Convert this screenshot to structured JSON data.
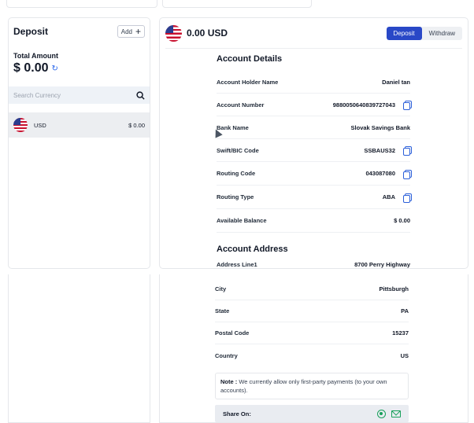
{
  "left": {
    "title": "Deposit",
    "add_label": "Add",
    "total_label": "Total Amount",
    "total_value": "$ 0.00",
    "search_placeholder": "Search Currency",
    "currencies": [
      {
        "code": "USD",
        "amount": "$ 0.00"
      }
    ]
  },
  "header": {
    "balance": "0.00 USD",
    "tabs": {
      "deposit": "Deposit",
      "withdraw": "Withdraw"
    }
  },
  "account_details": {
    "title": "Account Details",
    "rows": [
      {
        "label": "Account Holder Name",
        "value": "Daniel tan"
      },
      {
        "label": "Account Number",
        "value": "988005064083972704​3"
      },
      {
        "label": "Bank Name",
        "value": "Slovak Savings Bank"
      },
      {
        "label": "Swift/BIC Code",
        "value": "SSBAUS32"
      },
      {
        "label": "Routing Code",
        "value": "043087080"
      },
      {
        "label": "Routing Type",
        "value": "ABA"
      },
      {
        "label": "Available Balance",
        "value": "$ 0.00"
      }
    ]
  },
  "account_address": {
    "title": "Account Address",
    "rows": [
      {
        "label": "Address Line1",
        "value": "8700 Perry Highway"
      },
      {
        "label": "City",
        "value": "Pittsburgh"
      },
      {
        "label": "State",
        "value": "PA"
      },
      {
        "label": "Postal Code",
        "value": "15237"
      },
      {
        "label": "Country",
        "value": "US"
      }
    ]
  },
  "note": {
    "prefix": "Note :",
    "text": "We currently allow only first-party payments (to your own accounts)."
  },
  "share": {
    "label": "Share On:"
  },
  "colors": {
    "accent": "#2948c7",
    "copy": "#2b5fd9",
    "share": "#18a05b"
  }
}
